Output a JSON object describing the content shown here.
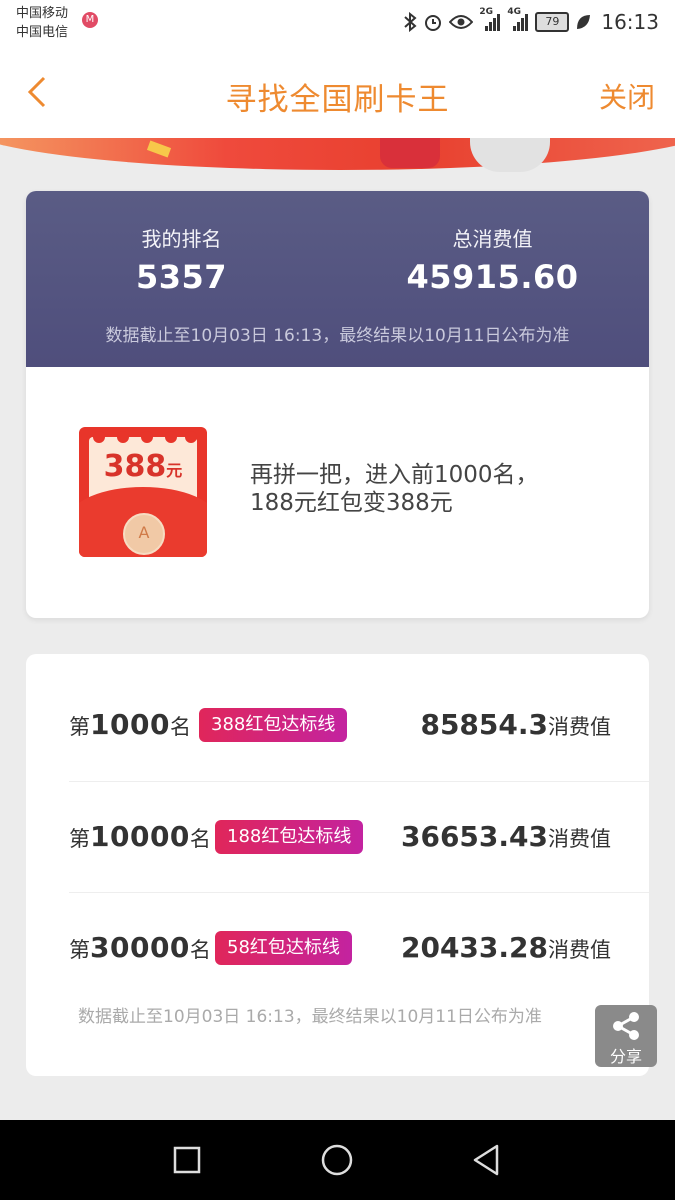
{
  "status_bar": {
    "carrier1": "中国移动",
    "carrier2": "中国电信",
    "signal1_label": "2G",
    "signal2_label": "4G",
    "battery": "79",
    "time": "16:13"
  },
  "header": {
    "title": "寻找全国刷卡王",
    "close_label": "关闭"
  },
  "rank_card": {
    "my_rank_label": "我的排名",
    "my_rank_value": "5357",
    "total_label": "总消费值",
    "total_value": "45915.60",
    "note": "数据截止至10月03日 16:13，最终结果以10月11日公布为准"
  },
  "promo": {
    "packet_amount": "388",
    "packet_unit": "元",
    "line1": "再拼一把，进入前1000名，",
    "line2": "188元红包变388元"
  },
  "thresholds": {
    "rows": [
      {
        "prefix": "第",
        "rank": "1000",
        "suffix": "名",
        "tag": "388红包达标线",
        "value": "85854.3",
        "unit": "消费值"
      },
      {
        "prefix": "第",
        "rank": "10000",
        "suffix": "名",
        "tag": "188红包达标线",
        "value": "36653.43",
        "unit": "消费值"
      },
      {
        "prefix": "第",
        "rank": "30000",
        "suffix": "名",
        "tag": "58红包达标线",
        "value": "20433.28",
        "unit": "消费值"
      }
    ],
    "note": "数据截止至10月03日 16:13，最终结果以10月11日公布为准"
  },
  "share": {
    "label": "分享"
  },
  "colors": {
    "accent": "#ee8a30",
    "header_bg": "#55567f",
    "tag_start": "#e0265a",
    "tag_end": "#c323a0"
  }
}
